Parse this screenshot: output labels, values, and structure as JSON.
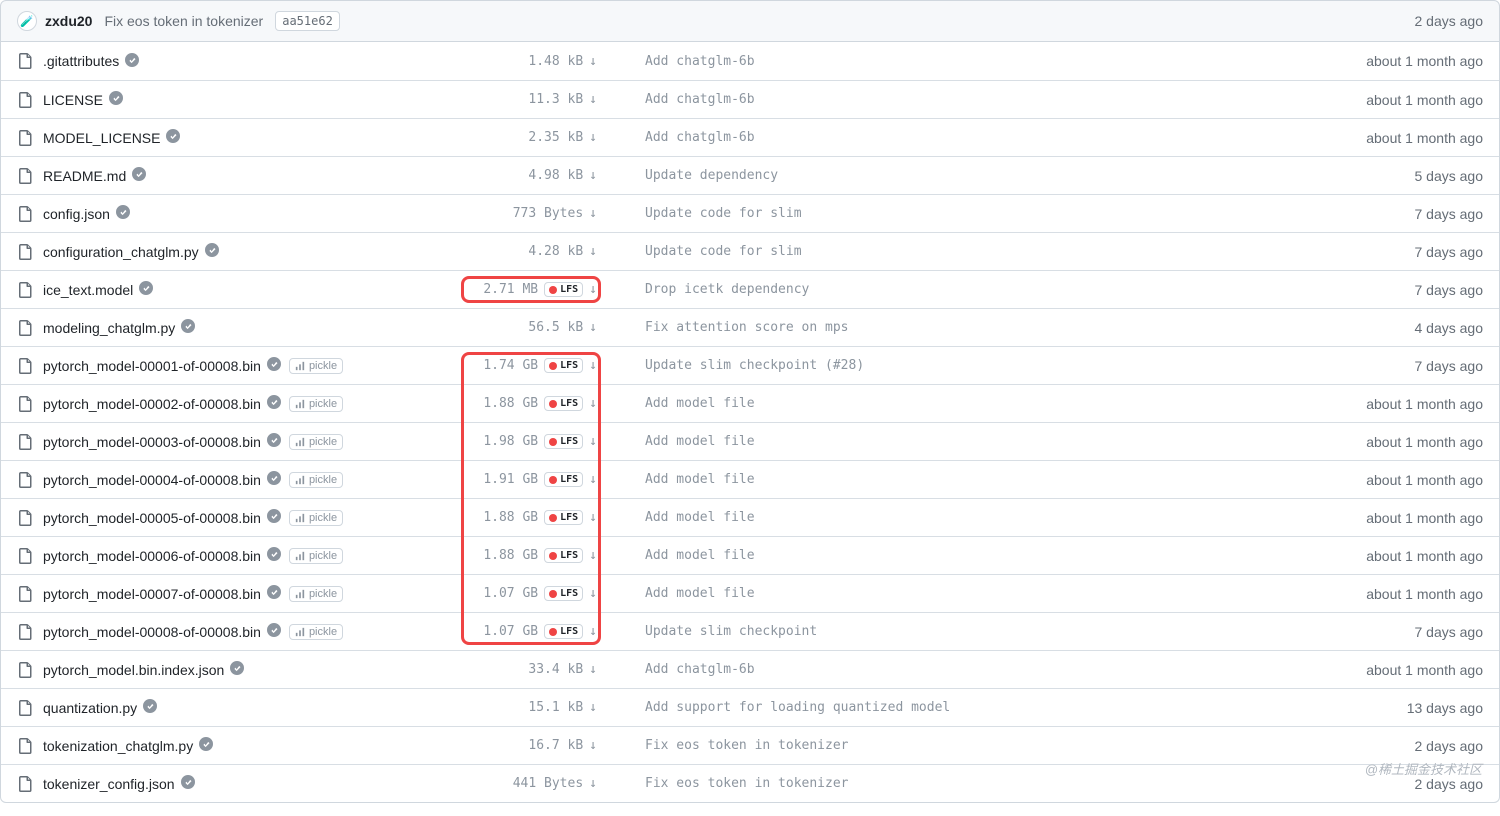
{
  "commit": {
    "author": "zxdu20",
    "message": "Fix eos token in tokenizer",
    "hash": "aa51e62",
    "time": "2 days ago",
    "avatar_emoji": "🧪"
  },
  "pickle_label": "pickle",
  "lfs_label": "LFS",
  "watermark": "@稀土掘金技术社区",
  "files": [
    {
      "name": ".gitattributes",
      "safe": true,
      "pickle": false,
      "size": "1.48 kB",
      "lfs": false,
      "msg": "Add chatglm-6b",
      "time": "about 1 month ago"
    },
    {
      "name": "LICENSE",
      "safe": true,
      "pickle": false,
      "size": "11.3 kB",
      "lfs": false,
      "msg": "Add chatglm-6b",
      "time": "about 1 month ago"
    },
    {
      "name": "MODEL_LICENSE",
      "safe": true,
      "pickle": false,
      "size": "2.35 kB",
      "lfs": false,
      "msg": "Add chatglm-6b",
      "time": "about 1 month ago"
    },
    {
      "name": "README.md",
      "safe": true,
      "pickle": false,
      "size": "4.98 kB",
      "lfs": false,
      "msg": "Update dependency",
      "time": "5 days ago"
    },
    {
      "name": "config.json",
      "safe": true,
      "pickle": false,
      "size": "773 Bytes",
      "lfs": false,
      "msg": "Update code for slim",
      "time": "7 days ago"
    },
    {
      "name": "configuration_chatglm.py",
      "safe": true,
      "pickle": false,
      "size": "4.28 kB",
      "lfs": false,
      "msg": "Update code for slim",
      "time": "7 days ago"
    },
    {
      "name": "ice_text.model",
      "safe": true,
      "pickle": false,
      "size": "2.71 MB",
      "lfs": true,
      "msg": "Drop icetk dependency",
      "time": "7 days ago"
    },
    {
      "name": "modeling_chatglm.py",
      "safe": true,
      "pickle": false,
      "size": "56.5 kB",
      "lfs": false,
      "msg": "Fix attention score on mps",
      "time": "4 days ago"
    },
    {
      "name": "pytorch_model-00001-of-00008.bin",
      "safe": true,
      "pickle": true,
      "size": "1.74 GB",
      "lfs": true,
      "msg": "Update slim checkpoint (#28)",
      "time": "7 days ago"
    },
    {
      "name": "pytorch_model-00002-of-00008.bin",
      "safe": true,
      "pickle": true,
      "size": "1.88 GB",
      "lfs": true,
      "msg": "Add model file",
      "time": "about 1 month ago"
    },
    {
      "name": "pytorch_model-00003-of-00008.bin",
      "safe": true,
      "pickle": true,
      "size": "1.98 GB",
      "lfs": true,
      "msg": "Add model file",
      "time": "about 1 month ago"
    },
    {
      "name": "pytorch_model-00004-of-00008.bin",
      "safe": true,
      "pickle": true,
      "size": "1.91 GB",
      "lfs": true,
      "msg": "Add model file",
      "time": "about 1 month ago"
    },
    {
      "name": "pytorch_model-00005-of-00008.bin",
      "safe": true,
      "pickle": true,
      "size": "1.88 GB",
      "lfs": true,
      "msg": "Add model file",
      "time": "about 1 month ago"
    },
    {
      "name": "pytorch_model-00006-of-00008.bin",
      "safe": true,
      "pickle": true,
      "size": "1.88 GB",
      "lfs": true,
      "msg": "Add model file",
      "time": "about 1 month ago"
    },
    {
      "name": "pytorch_model-00007-of-00008.bin",
      "safe": true,
      "pickle": true,
      "size": "1.07 GB",
      "lfs": true,
      "msg": "Add model file",
      "time": "about 1 month ago"
    },
    {
      "name": "pytorch_model-00008-of-00008.bin",
      "safe": true,
      "pickle": true,
      "size": "1.07 GB",
      "lfs": true,
      "msg": "Update slim checkpoint",
      "time": "7 days ago"
    },
    {
      "name": "pytorch_model.bin.index.json",
      "safe": true,
      "pickle": false,
      "size": "33.4 kB",
      "lfs": false,
      "msg": "Add chatglm-6b",
      "time": "about 1 month ago"
    },
    {
      "name": "quantization.py",
      "safe": true,
      "pickle": false,
      "size": "15.1 kB",
      "lfs": false,
      "msg": "Add support for loading quantized model",
      "time": "13 days ago"
    },
    {
      "name": "tokenization_chatglm.py",
      "safe": true,
      "pickle": false,
      "size": "16.7 kB",
      "lfs": false,
      "msg": "Fix eos token in tokenizer",
      "time": "2 days ago"
    },
    {
      "name": "tokenizer_config.json",
      "safe": true,
      "pickle": false,
      "size": "441 Bytes",
      "lfs": false,
      "msg": "Fix eos token in tokenizer",
      "time": "2 days ago"
    }
  ],
  "annotations": {
    "box1": {
      "row": 6
    },
    "box2": {
      "rows_start": 8,
      "rows_end": 15
    }
  }
}
